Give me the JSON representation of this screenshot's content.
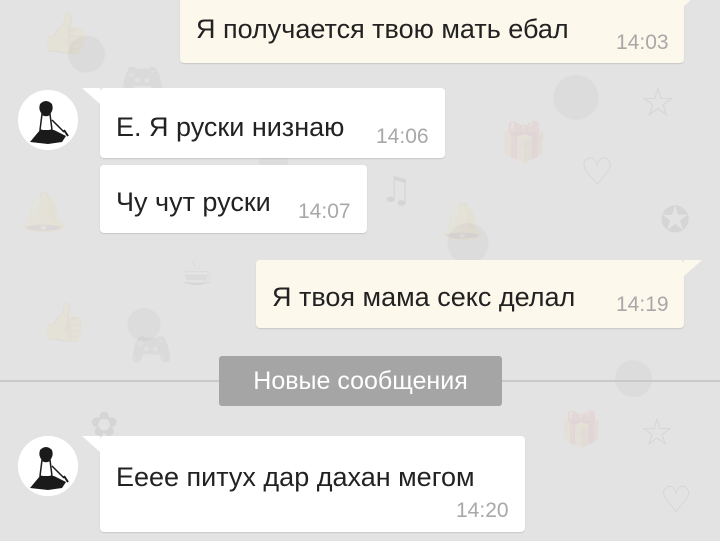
{
  "chat": {
    "divider_label": "Новые сообщения",
    "messages": [
      {
        "direction": "out",
        "text": "Я получается твою мать ебал",
        "time": "14:03"
      },
      {
        "direction": "in",
        "text": "Е. Я руски низнаю",
        "time": "14:06"
      },
      {
        "direction": "in",
        "text": "Чу чут руски",
        "time": "14:07"
      },
      {
        "direction": "out",
        "text": "Я твоя мама секс делал",
        "time": "14:19"
      },
      {
        "direction": "in",
        "text": "Ееее питух дар дахан мегом",
        "time": "14:20"
      }
    ]
  },
  "colors": {
    "background": "#e3e3e3",
    "outgoing_bubble": "#fdf8ec",
    "incoming_bubble": "#ffffff",
    "time_text": "#a8a8a8",
    "divider_pill": "#a5a5a5"
  },
  "icons": {
    "avatar": "person-sitting-avatar-icon"
  }
}
